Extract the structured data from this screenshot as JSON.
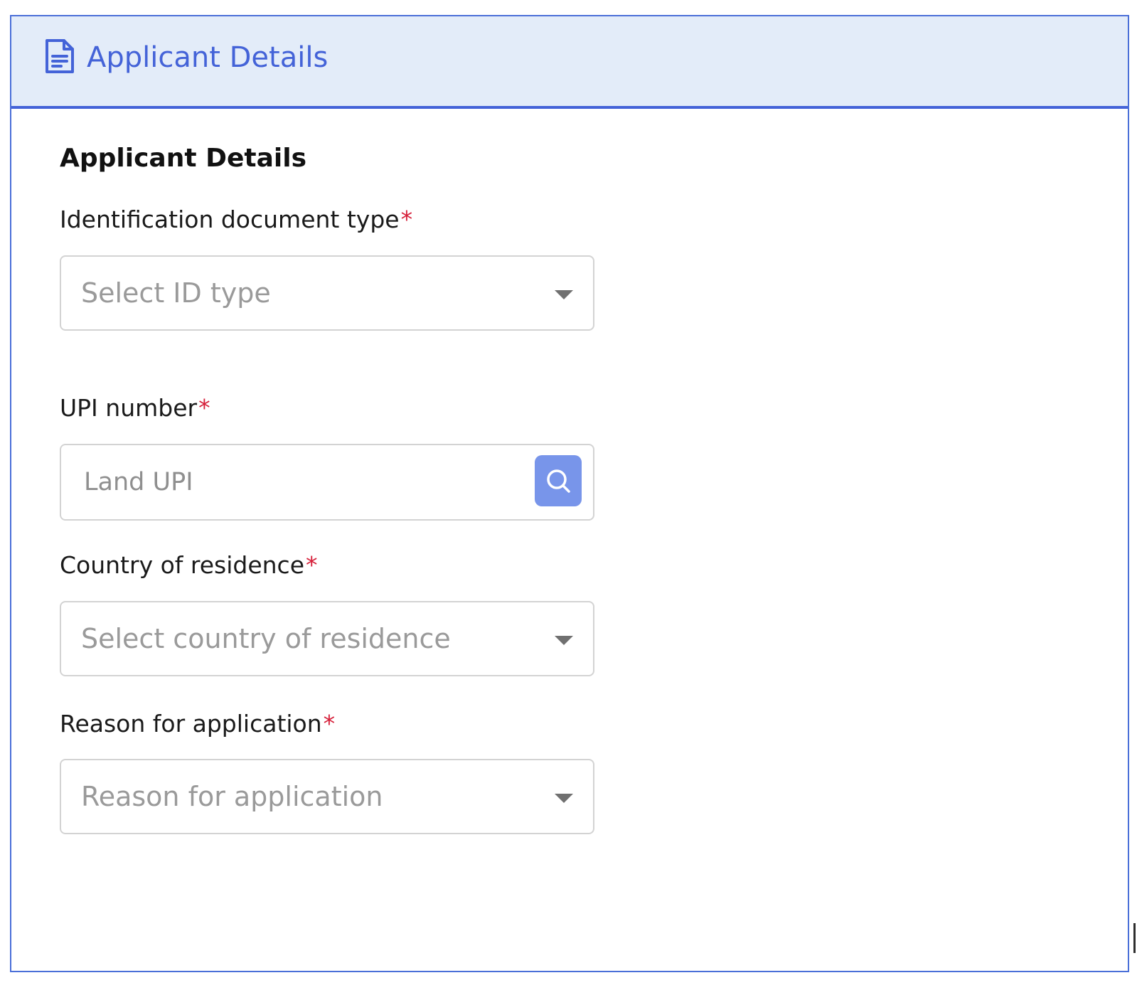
{
  "card": {
    "header_title": "Applicant Details",
    "header_icon": "document-icon"
  },
  "form": {
    "section_title": "Applicant Details",
    "fields": [
      {
        "label": "Identification document type",
        "required_mark": "*",
        "type": "select",
        "placeholder": "Select ID type"
      },
      {
        "label": "UPI number",
        "required_mark": "*",
        "type": "text-with-search",
        "placeholder": "Land UPI",
        "value": "",
        "action_icon": "search-icon"
      },
      {
        "label": "Country of residence",
        "required_mark": "*",
        "type": "select",
        "placeholder": "Select country of residence"
      },
      {
        "label": "Reason for application",
        "required_mark": "*",
        "type": "select",
        "placeholder": "Reason for application"
      }
    ]
  },
  "colors": {
    "accent": "#4463d8",
    "header_background": "#e3ecf9",
    "required": "#d6203a",
    "search_button": "#7895ea",
    "placeholder": "#9a9a9a"
  }
}
